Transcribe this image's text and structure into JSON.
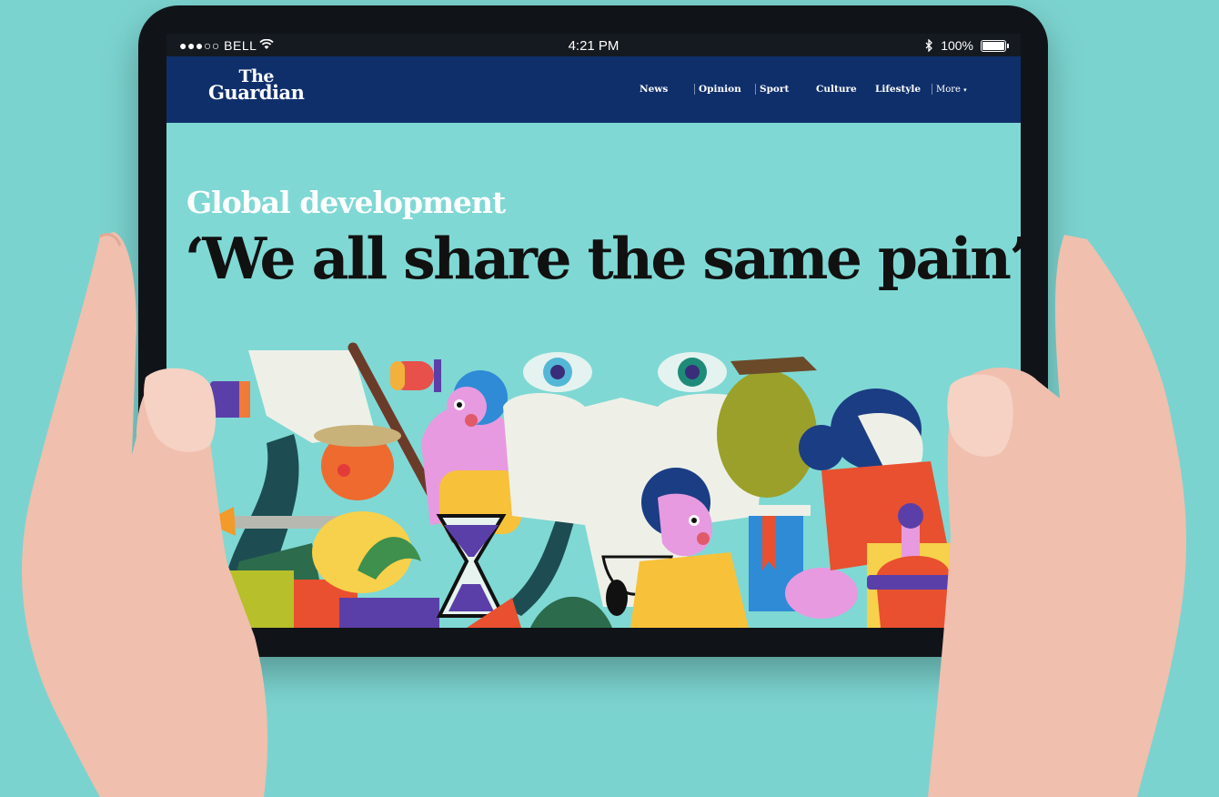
{
  "statusbar": {
    "carrier": "●●●○○ BELL",
    "time": "4:21 PM",
    "battery": "100%",
    "icons": [
      "wifi-icon",
      "bluetooth-icon",
      "battery-icon"
    ]
  },
  "header": {
    "logo_line1": "The",
    "logo_line2": "Guardian",
    "nav": [
      "News",
      "Opinion",
      "Sport",
      "Culture",
      "Lifestyle"
    ],
    "more": "More"
  },
  "article": {
    "kicker": "Global development",
    "headline": "‘We all share the same pain’"
  },
  "colors": {
    "background": "#7bd3cf",
    "header_blue": "#0f2f6b",
    "page_teal": "#7fd8d4",
    "kicker_white": "#ffffff",
    "headline_black": "#111111"
  }
}
